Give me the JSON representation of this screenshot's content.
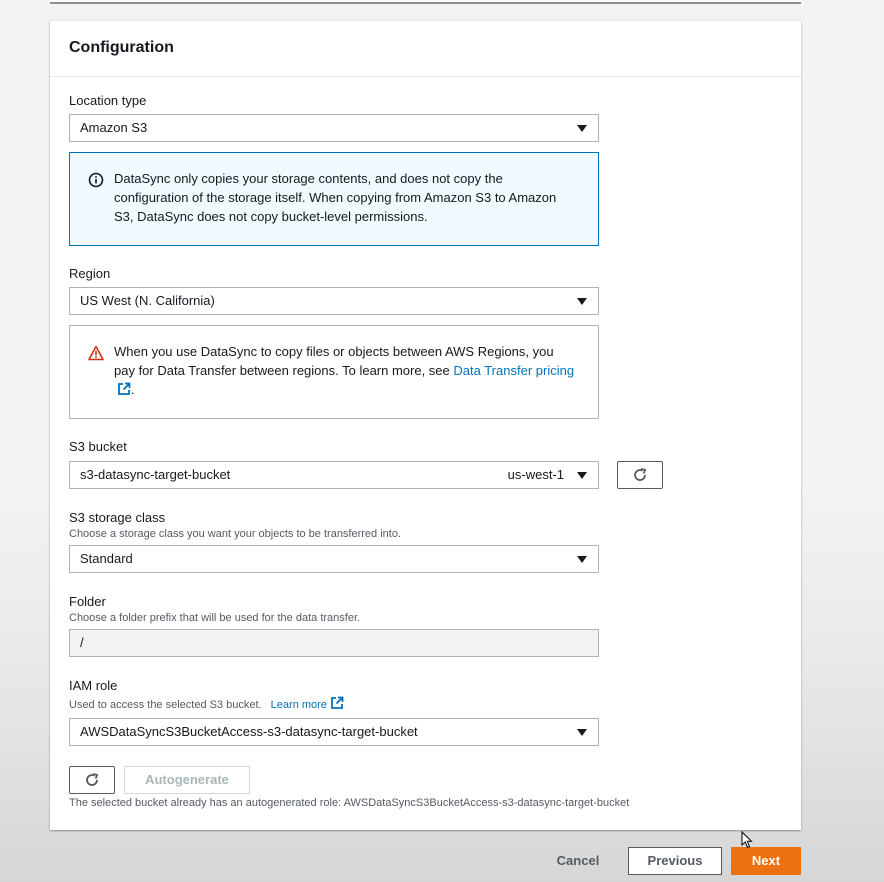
{
  "section": {
    "title": "Configuration"
  },
  "location_type": {
    "label": "Location type",
    "value": "Amazon S3"
  },
  "info_alert": {
    "text": "DataSync only copies your storage contents, and does not copy the configuration of the storage itself. When copying from Amazon S3 to Amazon S3, DataSync does not copy bucket-level permissions."
  },
  "region": {
    "label": "Region",
    "value": "US West (N. California)"
  },
  "warning_alert": {
    "text": "When you use DataSync to copy files or objects between AWS Regions, you pay for Data Transfer between regions. To learn more, see ",
    "link": "Data Transfer pricing",
    "suffix": "."
  },
  "s3_bucket": {
    "label": "S3 bucket",
    "value": "s3-datasync-target-bucket",
    "region": "us-west-1"
  },
  "storage_class": {
    "label": "S3 storage class",
    "description": "Choose a storage class you want your objects to be transferred into.",
    "value": "Standard"
  },
  "folder": {
    "label": "Folder",
    "description": "Choose a folder prefix that will be used for the data transfer.",
    "value": "/"
  },
  "iam_role": {
    "label": "IAM role",
    "description": "Used to access the selected S3 bucket.",
    "learn_more": "Learn more",
    "value": "AWSDataSyncS3BucketAccess-s3-datasync-target-bucket",
    "autogenerate_label": "Autogenerate",
    "note": "The selected bucket already has an autogenerated role: AWSDataSyncS3BucketAccess-s3-datasync-target-bucket"
  },
  "footer": {
    "cancel": "Cancel",
    "previous": "Previous",
    "next": "Next"
  },
  "colors": {
    "accent": "#ec7211",
    "link": "#0073bb",
    "info_border": "#0073bb",
    "warning": "#d13212"
  }
}
